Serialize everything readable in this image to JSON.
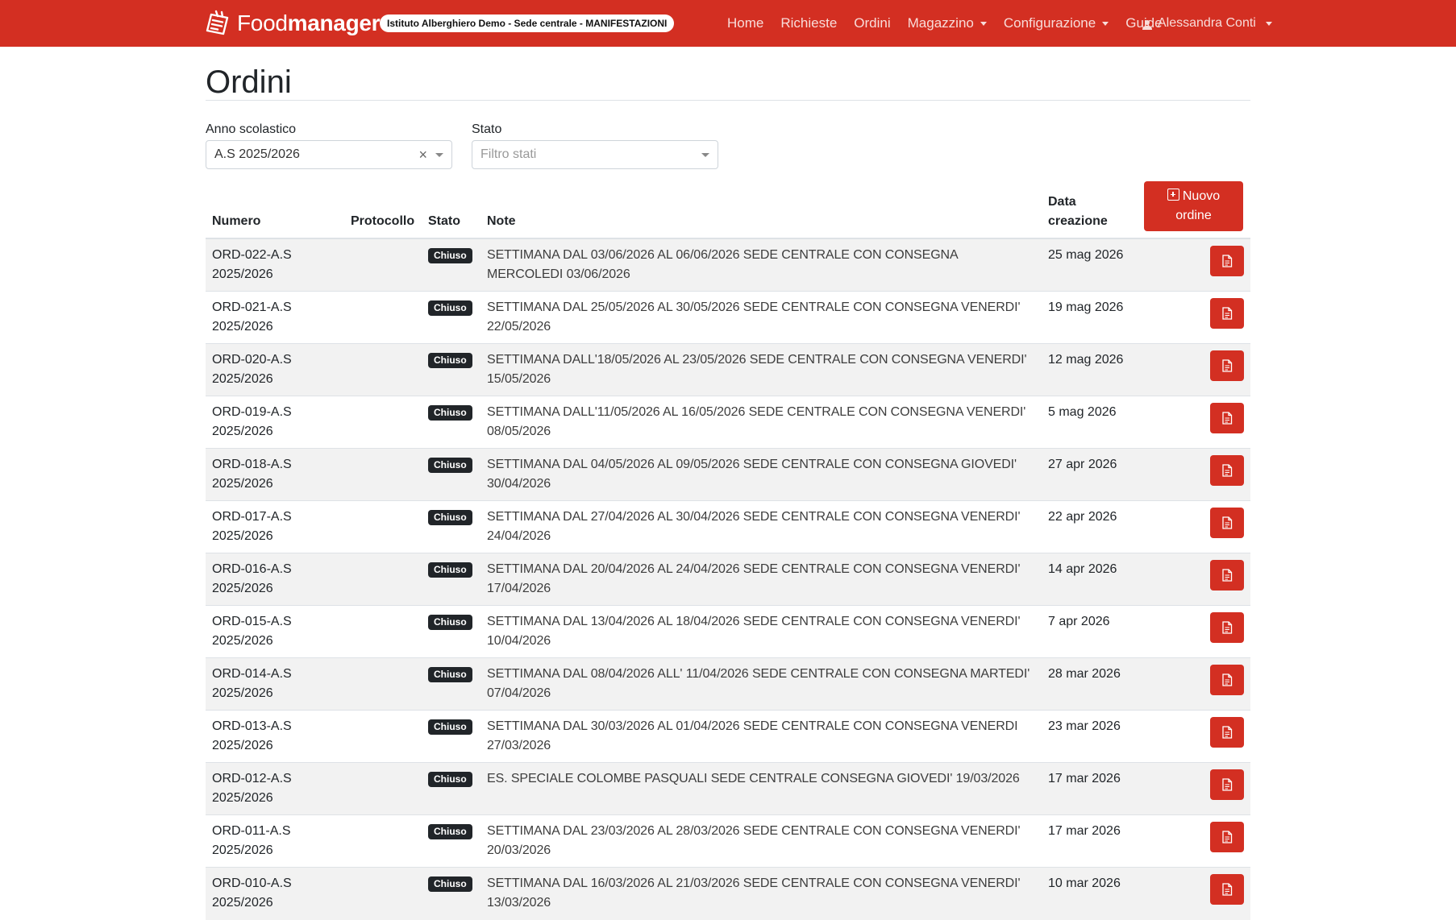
{
  "navbar": {
    "brand_light": "Food",
    "brand_bold": "manager",
    "context": "Istituto Alberghiero Demo - Sede centrale - MANIFESTAZIONI",
    "links": [
      {
        "label": "Home",
        "dropdown": false
      },
      {
        "label": "Richieste",
        "dropdown": false
      },
      {
        "label": "Ordini",
        "dropdown": false
      },
      {
        "label": "Magazzino",
        "dropdown": true
      },
      {
        "label": "Configurazione",
        "dropdown": true
      },
      {
        "label": "Guide",
        "dropdown": false
      }
    ],
    "user": "Alessandra Conti",
    "accent_color": "#d32f22"
  },
  "page": {
    "title": "Ordini"
  },
  "filters": {
    "anno": {
      "label": "Anno scolastico",
      "value": "A.S 2025/2026",
      "clear": "×"
    },
    "stato": {
      "label": "Stato",
      "placeholder": "Filtro stati"
    }
  },
  "table": {
    "headers": {
      "numero": "Numero",
      "protocollo": "Protocollo",
      "stato": "Stato",
      "note": "Note",
      "data_line1": "Data",
      "data_line2": "creazione"
    },
    "new_button": {
      "line1": "Nuovo",
      "line2": "ordine"
    },
    "rows": [
      {
        "num1": "ORD-022-A.S",
        "num2": "2025/2026",
        "protocollo": "",
        "stato": "Chiuso",
        "note": "SETTIMANA DAL 03/06/2026 AL 06/06/2026 SEDE CENTRALE CON CONSEGNA MERCOLEDI 03/06/2026",
        "data": "25 mag 2026"
      },
      {
        "num1": "ORD-021-A.S",
        "num2": "2025/2026",
        "protocollo": "",
        "stato": "Chiuso",
        "note": "SETTIMANA DAL 25/05/2026 AL 30/05/2026 SEDE CENTRALE CON CONSEGNA VENERDI' 22/05/2026",
        "data": "19 mag 2026"
      },
      {
        "num1": "ORD-020-A.S",
        "num2": "2025/2026",
        "protocollo": "",
        "stato": "Chiuso",
        "note": "SETTIMANA DALL'18/05/2026 AL 23/05/2026 SEDE CENTRALE CON CONSEGNA VENERDI' 15/05/2026",
        "data": "12 mag 2026"
      },
      {
        "num1": "ORD-019-A.S",
        "num2": "2025/2026",
        "protocollo": "",
        "stato": "Chiuso",
        "note": "SETTIMANA DALL'11/05/2026 AL 16/05/2026 SEDE CENTRALE CON CONSEGNA VENERDI' 08/05/2026",
        "data": "5 mag 2026"
      },
      {
        "num1": "ORD-018-A.S",
        "num2": "2025/2026",
        "protocollo": "",
        "stato": "Chiuso",
        "note": "SETTIMANA DAL 04/05/2026 AL 09/05/2026 SEDE CENTRALE CON CONSEGNA GIOVEDI' 30/04/2026",
        "data": "27 apr 2026"
      },
      {
        "num1": "ORD-017-A.S",
        "num2": "2025/2026",
        "protocollo": "",
        "stato": "Chiuso",
        "note": "SETTIMANA DAL 27/04/2026 AL 30/04/2026 SEDE CENTRALE CON CONSEGNA VENERDI' 24/04/2026",
        "data": "22 apr 2026"
      },
      {
        "num1": "ORD-016-A.S",
        "num2": "2025/2026",
        "protocollo": "",
        "stato": "Chiuso",
        "note": "SETTIMANA DAL 20/04/2026 AL 24/04/2026 SEDE CENTRALE CON CONSEGNA VENERDI' 17/04/2026",
        "data": "14 apr 2026"
      },
      {
        "num1": "ORD-015-A.S",
        "num2": "2025/2026",
        "protocollo": "",
        "stato": "Chiuso",
        "note": "SETTIMANA DAL 13/04/2026 AL 18/04/2026 SEDE CENTRALE CON CONSEGNA VENERDI' 10/04/2026",
        "data": "7 apr 2026"
      },
      {
        "num1": "ORD-014-A.S",
        "num2": "2025/2026",
        "protocollo": "",
        "stato": "Chiuso",
        "note": "SETTIMANA DAL 08/04/2026 ALL' 11/04/2026 SEDE CENTRALE CON CONSEGNA MARTEDI' 07/04/2026",
        "data": "28 mar 2026"
      },
      {
        "num1": "ORD-013-A.S",
        "num2": "2025/2026",
        "protocollo": "",
        "stato": "Chiuso",
        "note": "SETTIMANA DAL 30/03/2026 AL 01/04/2026 SEDE CENTRALE CON CONSEGNA VENERDI 27/03/2026",
        "data": "23 mar 2026"
      },
      {
        "num1": "ORD-012-A.S",
        "num2": "2025/2026",
        "protocollo": "",
        "stato": "Chiuso",
        "note": "ES. SPECIALE COLOMBE PASQUALI SEDE CENTRALE CONSEGNA GIOVEDI' 19/03/2026",
        "data": "17 mar 2026"
      },
      {
        "num1": "ORD-011-A.S",
        "num2": "2025/2026",
        "protocollo": "",
        "stato": "Chiuso",
        "note": "SETTIMANA DAL 23/03/2026 AL 28/03/2026 SEDE CENTRALE CON CONSEGNA VENERDI' 20/03/2026",
        "data": "17 mar 2026"
      },
      {
        "num1": "ORD-010-A.S",
        "num2": "2025/2026",
        "protocollo": "",
        "stato": "Chiuso",
        "note": "SETTIMANA DAL 16/03/2026 AL 21/03/2026 SEDE CENTRALE CON CONSEGNA VENERDI' 13/03/2026",
        "data": "10 mar 2026"
      }
    ],
    "row_action_icon": "document-icon"
  }
}
